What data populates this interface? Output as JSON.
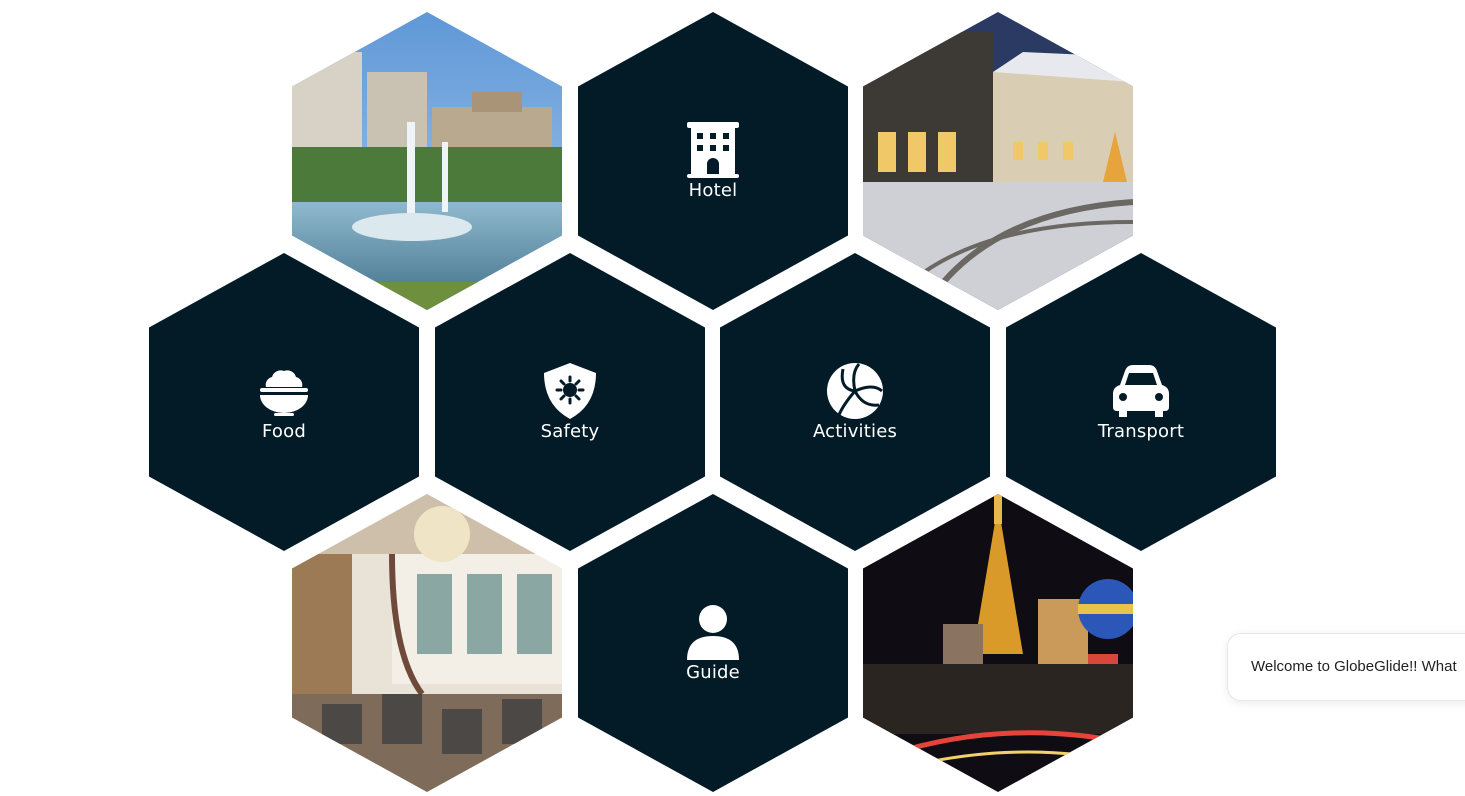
{
  "tiles": {
    "hotel": {
      "label": "Hotel",
      "icon": "hotel-building-icon"
    },
    "food": {
      "label": "Food",
      "icon": "food-bowl-icon"
    },
    "safety": {
      "label": "Safety",
      "icon": "safety-shield-icon"
    },
    "activities": {
      "label": "Activities",
      "icon": "volleyball-icon"
    },
    "transport": {
      "label": "Transport",
      "icon": "car-icon"
    },
    "guide": {
      "label": "Guide",
      "icon": "user-icon"
    }
  },
  "photos": [
    {
      "icon": "fountain-hotel-photo"
    },
    {
      "icon": "snowy-hotel-photo"
    },
    {
      "icon": "restaurant-interior-photo"
    },
    {
      "icon": "las-vegas-night-photo"
    }
  ],
  "chat": {
    "message": "Welcome to GlobeGlide!! What"
  },
  "colors": {
    "tile": "#021b27",
    "icon": "#ffffff",
    "background": "#ffffff"
  }
}
